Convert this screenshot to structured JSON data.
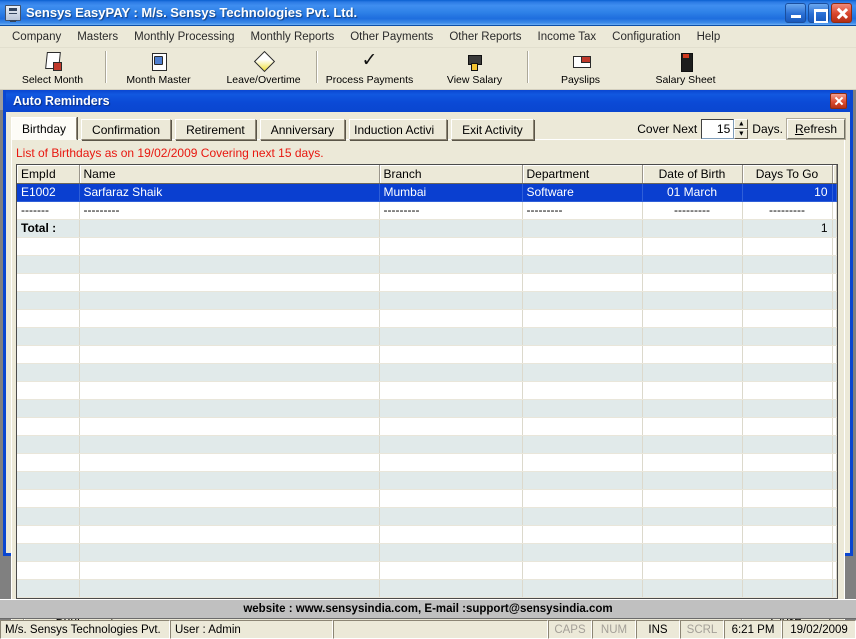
{
  "window": {
    "title": "Sensys EasyPAY : M/s. Sensys Technologies Pvt. Ltd.",
    "icon": "app-icon",
    "buttons": {
      "minimize": "minimize-button",
      "restore": "restore-button",
      "close": "close-button"
    }
  },
  "menubar": {
    "items": [
      {
        "label": "Company"
      },
      {
        "label": "Masters"
      },
      {
        "label": "Monthly Processing"
      },
      {
        "label": "Monthly Reports"
      },
      {
        "label": "Other Payments"
      },
      {
        "label": "Other Reports"
      },
      {
        "label": "Income Tax"
      },
      {
        "label": "Configuration"
      },
      {
        "label": "Help"
      }
    ]
  },
  "toolbar": {
    "items": [
      {
        "label": "Select Month",
        "icon": "select-month-icon"
      },
      {
        "label": "Month Master",
        "icon": "month-master-icon"
      },
      {
        "label": "Leave/Overtime",
        "icon": "leave-overtime-icon"
      },
      {
        "label": "Process Payments",
        "icon": "process-payments-icon"
      },
      {
        "label": "View Salary",
        "icon": "view-salary-icon"
      },
      {
        "label": "Payslips",
        "icon": "payslips-icon"
      },
      {
        "label": "Salary Sheet",
        "icon": "salary-sheet-icon"
      }
    ]
  },
  "dialog": {
    "title": "Auto Reminders",
    "close_icon": "dialog-close-icon",
    "tabs": [
      {
        "label": "Birthday",
        "active": true
      },
      {
        "label": "Confirmation",
        "active": false
      },
      {
        "label": "Retirement",
        "active": false
      },
      {
        "label": "Anniversary",
        "active": false
      },
      {
        "label": "Induction Activi",
        "active": false
      },
      {
        "label": "Exit Activity",
        "active": false
      }
    ],
    "cover": {
      "label": "Cover Next",
      "days_value": "15",
      "days_suffix": "Days.",
      "up_arrow": "▲",
      "down_arrow": "▼",
      "refresh_label": "Refresh",
      "refresh_accel": "R"
    },
    "notice": "List of Birthdays as on 19/02/2009 Covering next 15 days.",
    "grid": {
      "columns": [
        "EmpId",
        "Name",
        "Branch",
        "Department",
        "Date of Birth",
        "Days To Go"
      ],
      "rows": [
        {
          "selected": true,
          "cells": [
            "E1002",
            "Sarfaraz  Shaik",
            "Mumbai",
            "Software",
            "01 March",
            "10"
          ]
        },
        {
          "selected": false,
          "cells": [
            "-------",
            "---------",
            "---------",
            "---------",
            "---------",
            "---------"
          ]
        }
      ],
      "total_label": "Total :",
      "total_value": "1",
      "empty_row_count": 20
    },
    "footer": {
      "print_label": "Print",
      "print_accel": "P",
      "close_label": "Close",
      "close_accel": "C"
    }
  },
  "website_bar": {
    "text": "website : www.sensysindia.com, E-mail :support@sensysindia.com"
  },
  "statusbar": {
    "company": "M/s. Sensys Technologies Pvt.",
    "user": "User : Admin",
    "blank": "",
    "caps": "CAPS",
    "num": "NUM",
    "ins": "INS",
    "scrl": "SCRL",
    "time": "6:21 PM",
    "date": "19/02/2009"
  },
  "colors": {
    "title_blue": "#0a46d0",
    "notice_red": "#e8170f",
    "selection_blue": "#0a3fd0",
    "total_blue": "#0a1ed0",
    "row_alt": "#e1eaea",
    "chrome": "#ece9d8"
  }
}
